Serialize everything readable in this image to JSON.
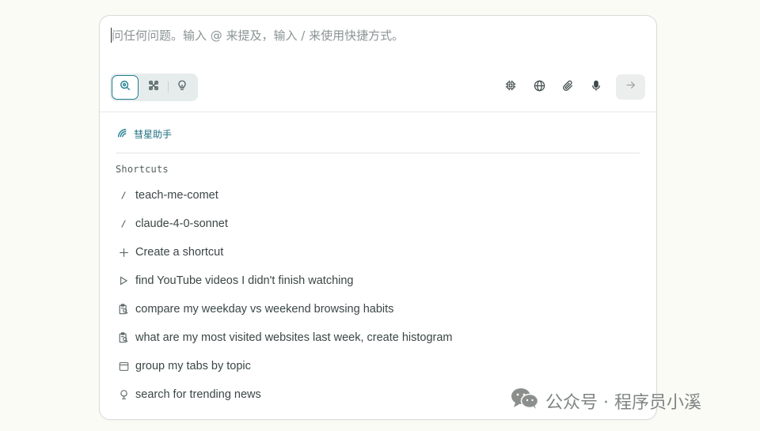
{
  "search": {
    "placeholder": "问任何问题。输入 @ 来提及，输入 / 来使用快捷方式。",
    "value": ""
  },
  "modes": [
    {
      "name": "search",
      "icon": "search-icon",
      "active": true
    },
    {
      "name": "research",
      "icon": "research-icon",
      "active": false
    },
    {
      "name": "labs",
      "icon": "lightbulb-icon",
      "active": false
    }
  ],
  "tools": [
    "chip-icon",
    "globe-icon",
    "paperclip-icon",
    "microphone-icon"
  ],
  "submit": {
    "icon": "arrow-right-icon"
  },
  "assistant": {
    "label": "彗星助手"
  },
  "shortcuts_title": "Shortcuts",
  "shortcuts": [
    {
      "icon": "slash-icon",
      "label": "teach-me-comet"
    },
    {
      "icon": "slash-icon",
      "label": "claude-4-0-sonnet"
    },
    {
      "icon": "plus-icon",
      "label": "Create a shortcut"
    },
    {
      "icon": "play-icon",
      "label": "find YouTube videos I didn't finish watching"
    },
    {
      "icon": "clipboard-search-icon",
      "label": "compare my weekday vs weekend browsing habits"
    },
    {
      "icon": "clipboard-search-icon",
      "label": "what are my most visited websites last week, create histogram"
    },
    {
      "icon": "browser-window-icon",
      "label": "group my tabs by topic"
    },
    {
      "icon": "globe-stand-icon",
      "label": "search for trending news"
    }
  ],
  "watermark": {
    "text": "公众号 · 程序员小溪"
  },
  "colors": {
    "accent": "#1f7f8f",
    "background": "#fbfbf6"
  }
}
